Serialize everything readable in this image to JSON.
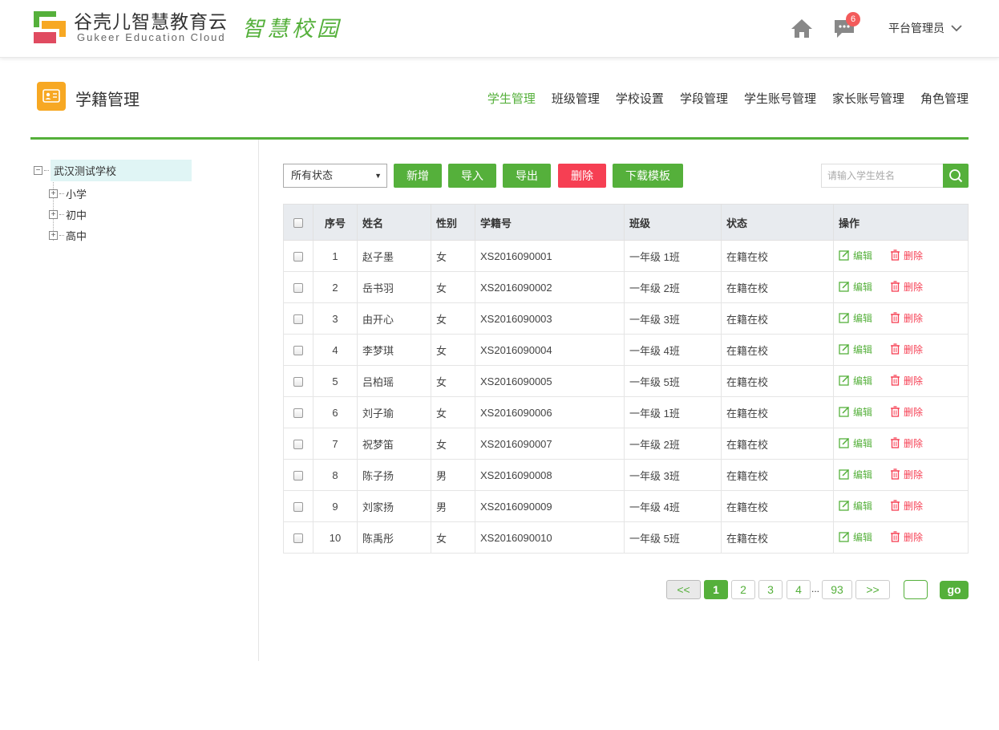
{
  "header": {
    "brand_cn": "谷壳儿智慧教育云",
    "brand_en": "Gukeer Education Cloud",
    "slogan": "智慧校园",
    "message_count": "6",
    "user_name": "平台管理员"
  },
  "module": {
    "title": "学籍管理",
    "nav": [
      "学生管理",
      "班级管理",
      "学校设置",
      "学段管理",
      "学生账号管理",
      "家长账号管理",
      "角色管理"
    ],
    "active_index": 0
  },
  "tree": {
    "root": "武汉测试学校",
    "children": [
      "小学",
      "初中",
      "高中"
    ]
  },
  "toolbar": {
    "status_selected": "所有状态",
    "add": "新增",
    "import": "导入",
    "export": "导出",
    "delete": "删除",
    "download_template": "下载模板",
    "search_placeholder": "请输入学生姓名"
  },
  "table": {
    "headers": [
      "序号",
      "姓名",
      "性别",
      "学籍号",
      "班级",
      "状态",
      "操作"
    ],
    "edit_label": "编辑",
    "delete_label": "删除",
    "rows": [
      [
        "1",
        "赵子墨",
        "女",
        "XS2016090001",
        "一年级 1班",
        "在籍在校"
      ],
      [
        "2",
        "岳书羽",
        "女",
        "XS2016090002",
        "一年级 2班",
        "在籍在校"
      ],
      [
        "3",
        "由开心",
        "女",
        "XS2016090003",
        "一年级 3班",
        "在籍在校"
      ],
      [
        "4",
        "李梦琪",
        "女",
        "XS2016090004",
        "一年级 4班",
        "在籍在校"
      ],
      [
        "5",
        "吕柏瑶",
        "女",
        "XS2016090005",
        "一年级 5班",
        "在籍在校"
      ],
      [
        "6",
        "刘子瑜",
        "女",
        "XS2016090006",
        "一年级 1班",
        "在籍在校"
      ],
      [
        "7",
        "祝梦笛",
        "女",
        "XS2016090007",
        "一年级 2班",
        "在籍在校"
      ],
      [
        "8",
        "陈子扬",
        "男",
        "XS2016090008",
        "一年级 3班",
        "在籍在校"
      ],
      [
        "9",
        "刘家扬",
        "男",
        "XS2016090009",
        "一年级 4班",
        "在籍在校"
      ],
      [
        "10",
        "陈禹彤",
        "女",
        "XS2016090010",
        "一年级 5班",
        "在籍在校"
      ]
    ]
  },
  "pagination": {
    "prev": "<<",
    "next": ">>",
    "pages": [
      "1",
      "2",
      "3",
      "4"
    ],
    "ellipsis": "...",
    "last": "93",
    "current": "1",
    "go": "go"
  },
  "colors": {
    "accent": "#55b03b",
    "danger": "#f63f53",
    "module_icon": "#f7a823"
  }
}
